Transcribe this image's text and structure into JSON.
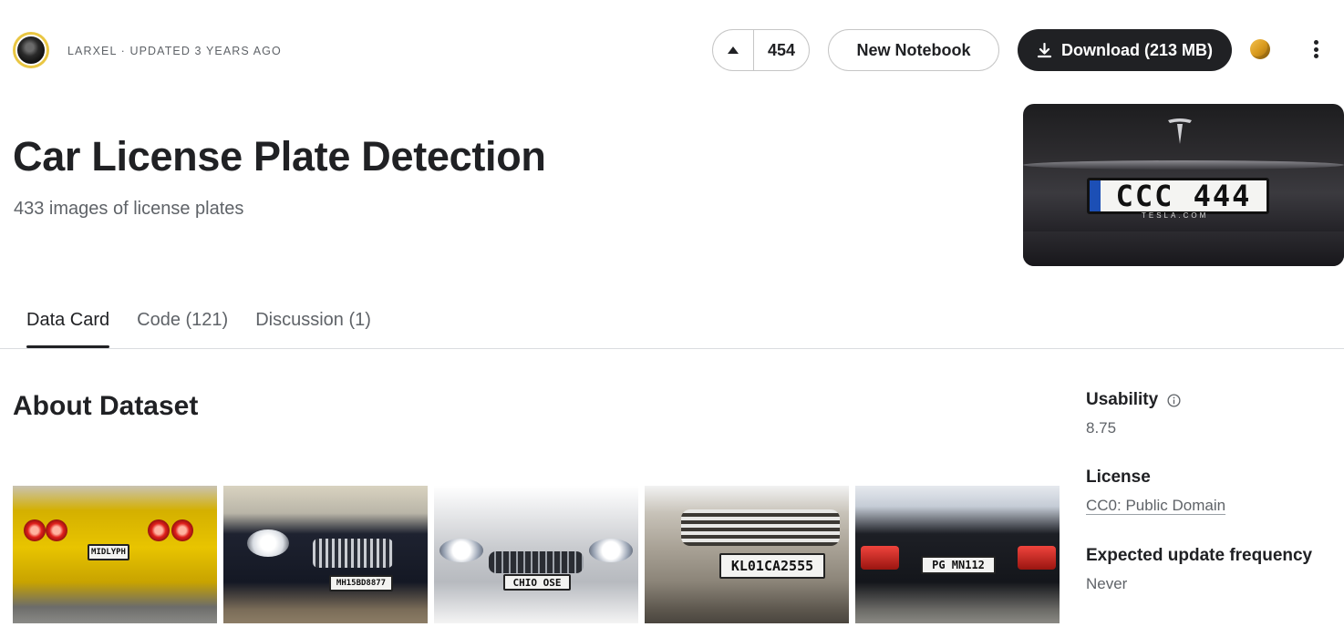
{
  "header": {
    "owner_line": "LARXEL · UPDATED 3 YEARS AGO",
    "vote_count": "454",
    "new_notebook_label": "New Notebook",
    "download_label": "Download (213 MB)"
  },
  "dataset": {
    "title": "Car License Plate Detection",
    "subtitle": "433 images of license plates",
    "cover_plate_text": "CCC 444",
    "cover_frame_text": "TESLA.COM"
  },
  "tabs": [
    {
      "label": "Data Card"
    },
    {
      "label": "Code (121)"
    },
    {
      "label": "Discussion (1)"
    }
  ],
  "about": {
    "title": "About Dataset",
    "thumbnails": [
      {
        "plate": "MIDLYPH"
      },
      {
        "plate": "MH15BD8877"
      },
      {
        "plate": "CHIO OSE"
      },
      {
        "plate": "KL01CA2555"
      },
      {
        "plate": "PG MN112"
      }
    ]
  },
  "sidebar": {
    "usability_label": "Usability",
    "usability_value": "8.75",
    "license_label": "License",
    "license_value": "CC0: Public Domain",
    "frequency_label": "Expected update frequency",
    "frequency_value": "Never"
  },
  "colors": {
    "primary_button": "#202124",
    "avatar_ring": "#e9c642",
    "medal": "#d99a1e",
    "text_muted": "#5f6368"
  },
  "icons": {
    "vote": "upvote-arrow-icon",
    "download": "download-icon",
    "medal": "gold-medal-icon",
    "more": "more-vertical-icon",
    "info": "info-icon"
  }
}
